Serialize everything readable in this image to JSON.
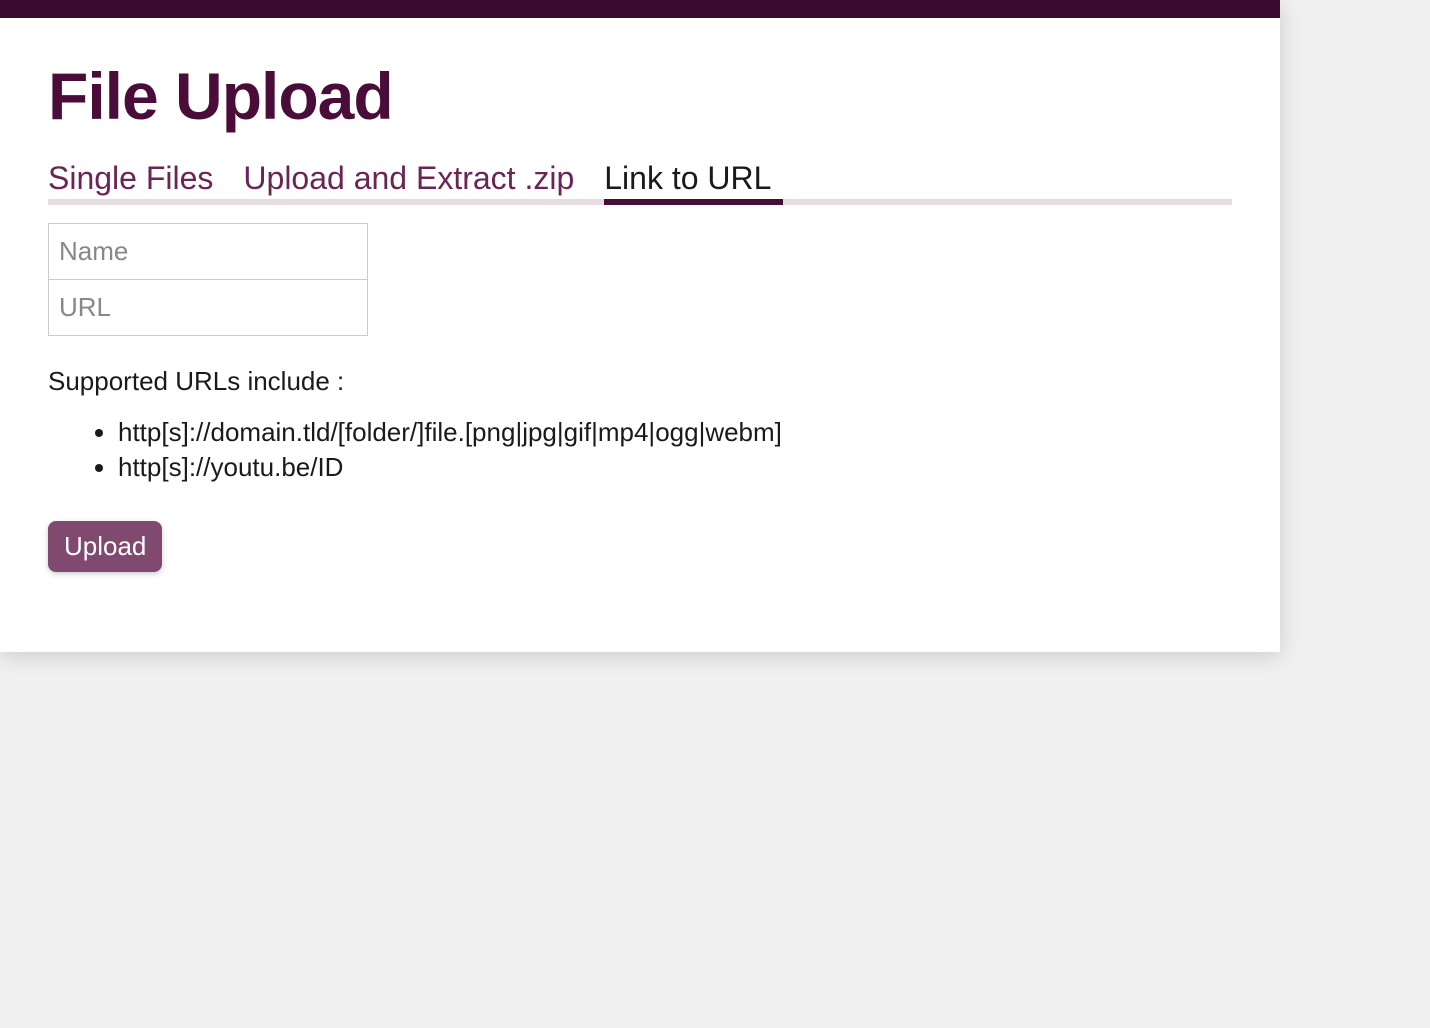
{
  "header": {
    "title": "File Upload"
  },
  "tabs": [
    {
      "label": "Single Files",
      "active": false
    },
    {
      "label": "Upload and Extract .zip",
      "active": false
    },
    {
      "label": "Link to URL",
      "active": true
    }
  ],
  "form": {
    "name": {
      "placeholder": "Name",
      "value": ""
    },
    "url": {
      "placeholder": "URL",
      "value": ""
    }
  },
  "supported": {
    "label": "Supported URLs include :",
    "items": [
      "http[s]://domain.tld/[folder/]file.[png|jpg|gif|mp4|ogg|webm]",
      "http[s]://youtu.be/ID"
    ]
  },
  "actions": {
    "upload_label": "Upload"
  },
  "colors": {
    "brand_dark": "#4a0d3a",
    "brand_top": "#3a0b2e",
    "button_bg": "#7f4970",
    "tab_inactive": "#6a2456",
    "tab_underline_bg": "#e6dde3"
  }
}
